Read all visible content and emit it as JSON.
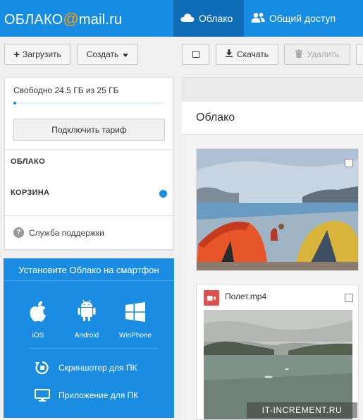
{
  "header": {
    "logo_left": "ОБЛАКО",
    "logo_at": "@",
    "logo_right": "mail.ru",
    "tabs": [
      {
        "label": "Облако",
        "icon": "cloud-icon",
        "active": true
      },
      {
        "label": "Общий доступ",
        "icon": "people-icon",
        "active": false
      }
    ],
    "colors": {
      "bar": "#168de2",
      "active_tab": "#0e6db6",
      "logo_at": "#ff9e00"
    }
  },
  "toolbar": {
    "upload_label": "Загрузить",
    "create_label": "Создать",
    "download_label": "Скачать",
    "delete_label": "Удалить"
  },
  "sidebar": {
    "storage_text": "Свободно 24.5 ГБ из 25 ГБ",
    "storage_used_fraction": 0.02,
    "tariff_button": "Подключить тариф",
    "folders": [
      {
        "label": "ОБЛАКО"
      },
      {
        "label": "КОРЗИНА"
      }
    ],
    "support_label": "Служба поддержки"
  },
  "promo": {
    "title": "Установите Облако на смартфон",
    "platforms": [
      {
        "label": "iOS",
        "icon": "apple-icon"
      },
      {
        "label": "Android",
        "icon": "android-icon"
      },
      {
        "label": "WinPhone",
        "icon": "windows-icon"
      }
    ],
    "links": [
      {
        "label": "Скриншотер для ПК",
        "icon": "screenshot-icon"
      },
      {
        "label": "Приложение для ПК",
        "icon": "monitor-icon"
      }
    ]
  },
  "main": {
    "title": "Облако",
    "files": [
      {
        "type": "image",
        "name": ""
      },
      {
        "type": "video",
        "name": "Полет.mp4"
      }
    ]
  },
  "watermark": "IT-INCREMENT.RU"
}
